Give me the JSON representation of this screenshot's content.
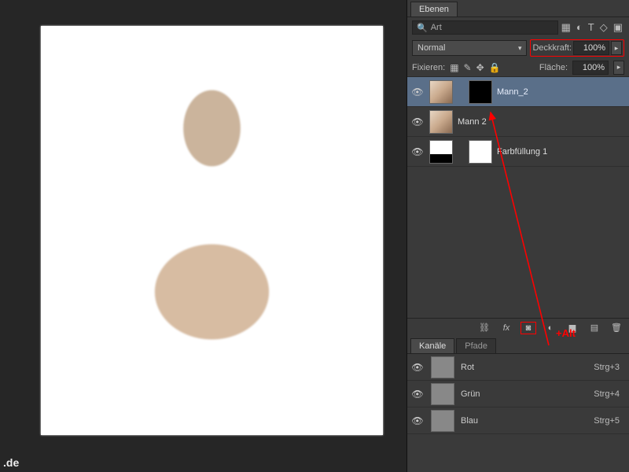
{
  "panels": {
    "layers_tab": "Ebenen",
    "channels_tab": "Kanäle",
    "paths_tab": "Pfade"
  },
  "search": {
    "label": "Art",
    "icon": "🔍"
  },
  "blend": {
    "mode": "Normal"
  },
  "opacity": {
    "label": "Deckkraft:",
    "value": "100%"
  },
  "fill": {
    "label": "Fläche:",
    "value": "100%"
  },
  "lock": {
    "label": "Fixieren:"
  },
  "layers": [
    {
      "name": "Mann_2",
      "mask": "black",
      "selected": true
    },
    {
      "name": "Mann 2",
      "mask": null,
      "selected": false
    },
    {
      "name": "Farbfüllung 1",
      "mask": "white",
      "selected": false,
      "adj": true
    }
  ],
  "channels": [
    {
      "name": "Rot",
      "shortcut": "Strg+3"
    },
    {
      "name": "Grün",
      "shortcut": "Strg+4"
    },
    {
      "name": "Blau",
      "shortcut": "Strg+5"
    }
  ],
  "annotation": {
    "text": "+Alt"
  },
  "watermark": ".de"
}
